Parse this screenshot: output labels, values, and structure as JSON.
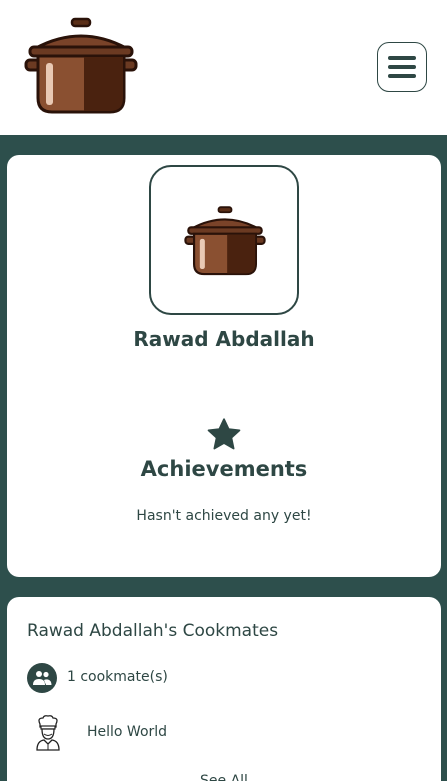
{
  "header": {
    "logo_icon": "cooking-pot-icon",
    "menu_icon": "hamburger-menu-icon"
  },
  "profile": {
    "avatar_icon": "cooking-pot-icon",
    "name": "Rawad Abdallah"
  },
  "achievements": {
    "icon": "star-icon",
    "title": "Achievements",
    "empty_text": "Hasn't achieved any yet!"
  },
  "cookmates": {
    "title": "Rawad Abdallah's Cookmates",
    "count_icon": "users-icon",
    "count_text": "1 cookmate(s)",
    "items": [
      {
        "icon": "chef-avatar-icon",
        "name": "Hello World"
      }
    ],
    "see_all": "See All"
  },
  "colors": {
    "background": "#2d4f4c",
    "accent": "#2e4744",
    "card": "#ffffff",
    "pot_brown": "#6b3a22"
  }
}
